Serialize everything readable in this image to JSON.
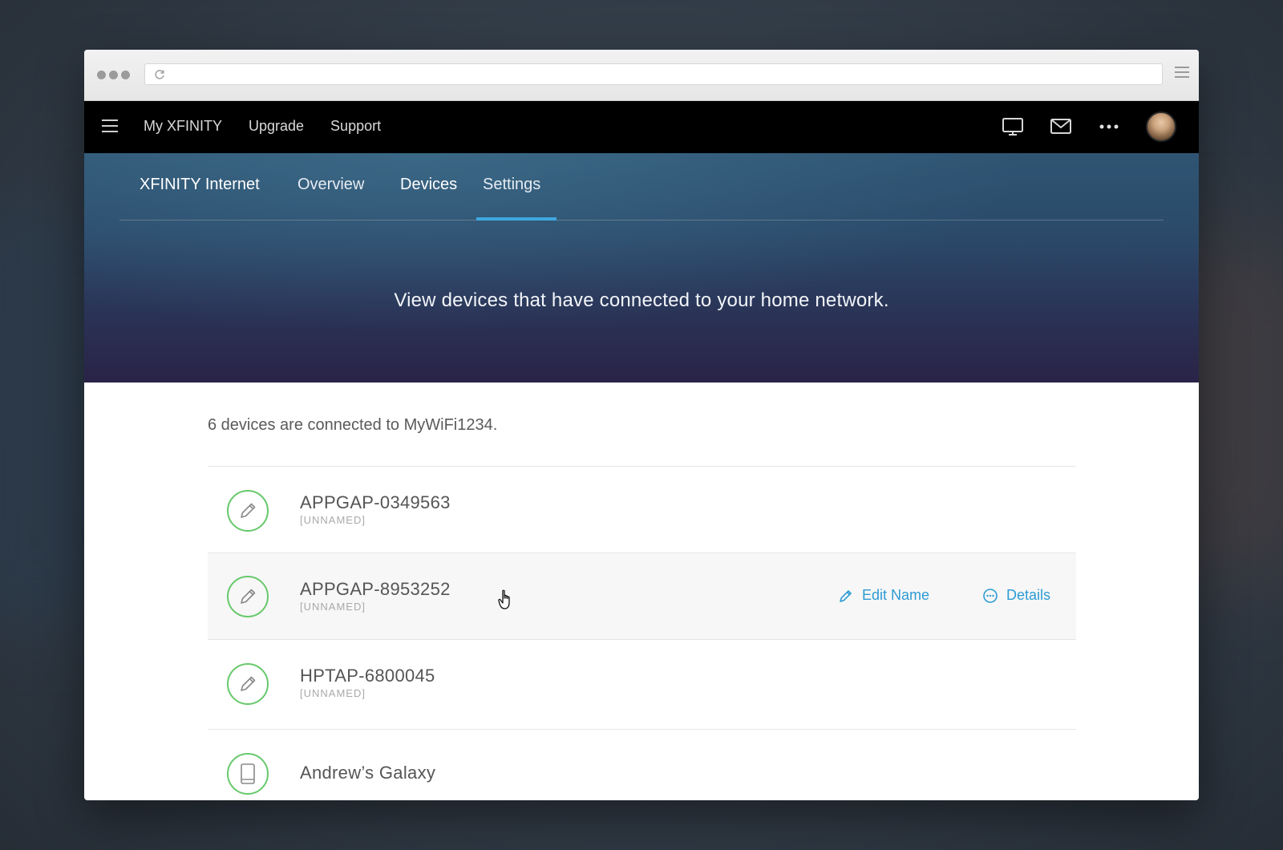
{
  "topnav": {
    "links": [
      "My XFINITY",
      "Upgrade",
      "Support"
    ],
    "icons": [
      "tv-icon",
      "mail-icon",
      "more-icon"
    ]
  },
  "subnav": {
    "product": "XFINITY Internet",
    "tabs": [
      "Overview",
      "Devices",
      "Settings"
    ],
    "active_tab": "Devices"
  },
  "hero": {
    "message": "View devices that have connected to your home network."
  },
  "devices": {
    "summary": "6 devices are connected to MyWiFi1234.",
    "items": [
      {
        "name": "APPGAP-0349563",
        "tag": "[UNNAMED]",
        "icon": "pencil-icon"
      },
      {
        "name": "APPGAP-8953252",
        "tag": "[UNNAMED]",
        "icon": "pencil-icon"
      },
      {
        "name": "HPTAP-6800045",
        "tag": "[UNNAMED]",
        "icon": "pencil-icon"
      },
      {
        "name": "Andrew’s Galaxy",
        "tag": "",
        "icon": "tablet-icon"
      }
    ],
    "actions": {
      "edit": "Edit Name",
      "details": "Details"
    }
  },
  "colors": {
    "accent": "#2d9bd3",
    "device_ring": "#67c96b",
    "topbar": "#000000"
  }
}
